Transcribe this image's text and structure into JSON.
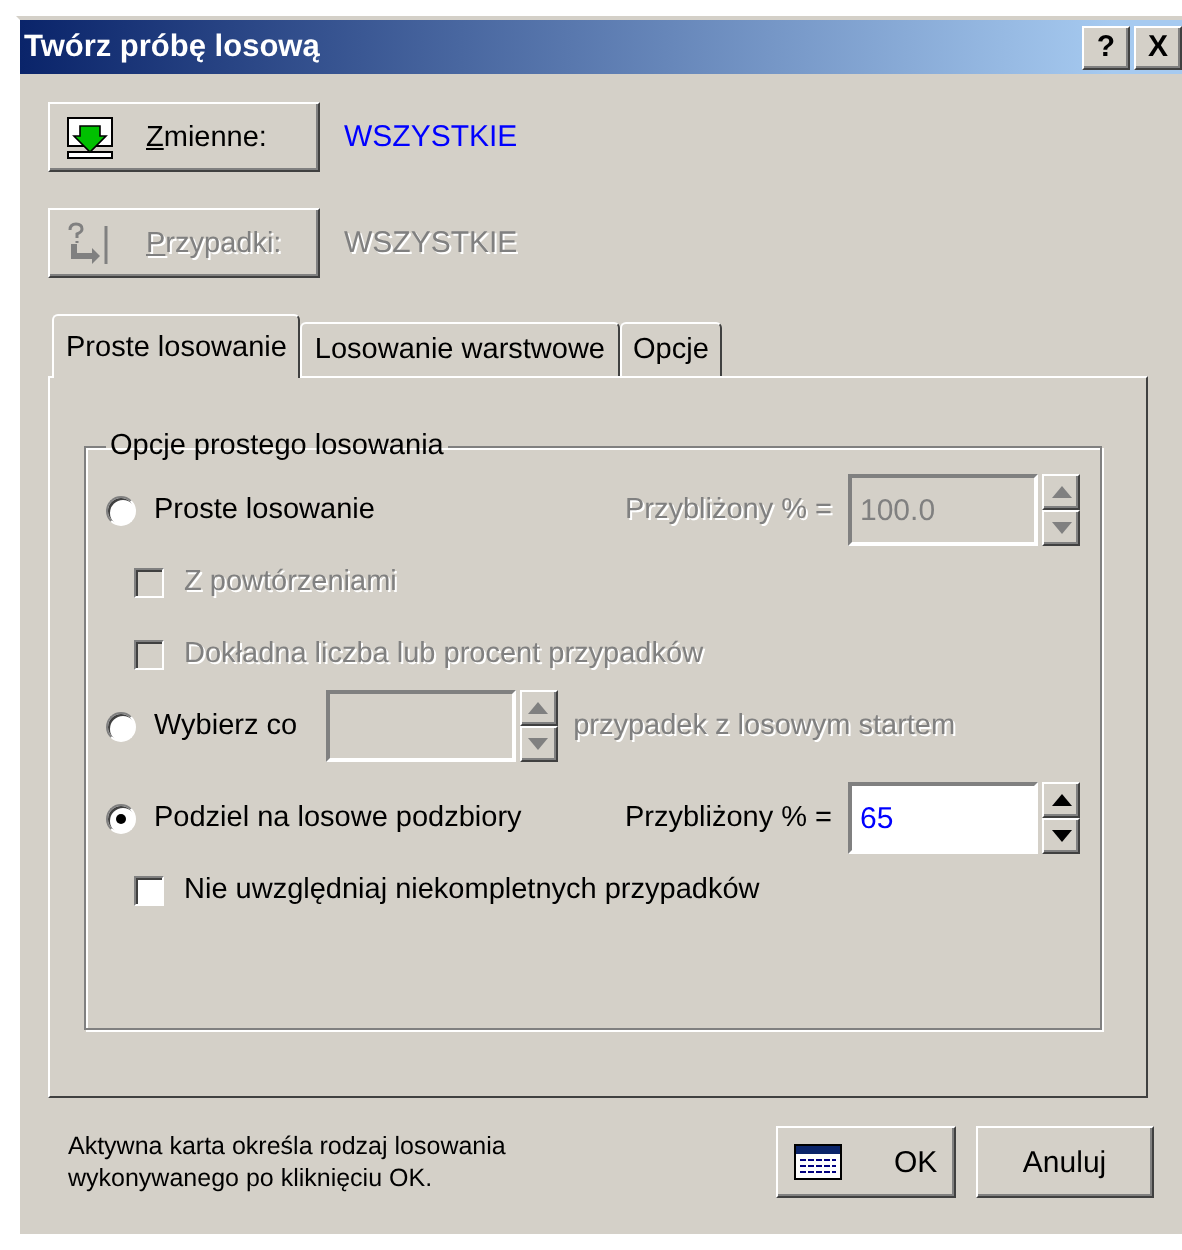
{
  "window": {
    "title": "Twórz próbę losową",
    "help_button": "?",
    "close_button": "X"
  },
  "selectors": [
    {
      "label": "Zmienne:",
      "value": "WSZYSTKIE",
      "disabled": false
    },
    {
      "label": "Przypadki:",
      "value": "WSZYSTKIE",
      "disabled": true
    }
  ],
  "tabs": [
    {
      "label": "Proste losowanie",
      "selected": true
    },
    {
      "label": "Losowanie warstwowe",
      "selected": false
    },
    {
      "label": "Opcje",
      "selected": false
    }
  ],
  "group": {
    "title": "Opcje prostego losowania",
    "rows": [
      {
        "kind": "radio",
        "label": "Proste losowanie",
        "selected": false,
        "field": {
          "label": "Przybliżony % =",
          "value": "100.0",
          "disabled": true
        }
      },
      {
        "kind": "checkbox",
        "label": "Z powtórzeniami",
        "checked": false,
        "disabled": true
      },
      {
        "kind": "checkbox",
        "label": "Dokładna liczba lub procent przypadków",
        "checked": false,
        "disabled": true
      },
      {
        "kind": "radio",
        "label": "Wybierz co",
        "selected": false,
        "field": {
          "suffix": "przypadek z losowym startem",
          "disabled": true
        }
      },
      {
        "kind": "radio",
        "label": "Podziel na losowe podzbiory",
        "selected": true,
        "field": {
          "label": "Przybliżony % =",
          "value": "65",
          "disabled": false
        }
      },
      {
        "kind": "checkbox",
        "label": "Nie uwzględniaj niekompletnych przypadków",
        "checked": false,
        "disabled": false
      }
    ]
  },
  "footer": {
    "hint": "Aktywna karta określa rodzaj losowania wykonywanego po kliknięciu OK.",
    "ok_button": "OK",
    "cancel_button": "Anuluj"
  }
}
